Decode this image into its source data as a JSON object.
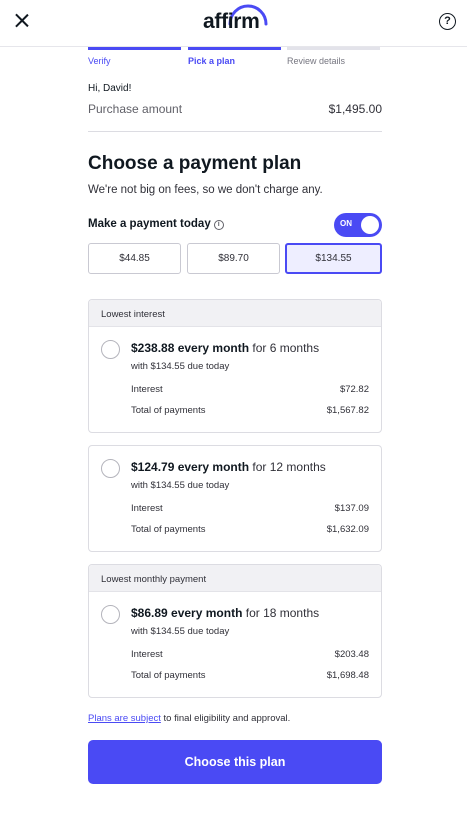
{
  "header": {
    "logo": "affirm",
    "help": "?"
  },
  "steps": [
    {
      "label": "Verify",
      "state": "done"
    },
    {
      "label": "Pick a plan",
      "state": "active"
    },
    {
      "label": "Review details",
      "state": "todo"
    }
  ],
  "greeting": "Hi, David!",
  "purchase": {
    "label": "Purchase amount",
    "value": "$1,495.00"
  },
  "heading": "Choose a payment plan",
  "subtext": "We're not big on fees, so we don't charge any.",
  "pay_today": {
    "label": "Make a payment today",
    "info_icon": "i",
    "toggle_label": "ON",
    "toggle_on": true,
    "amounts": [
      "$44.85",
      "$89.70",
      "$134.55"
    ],
    "selected_amount": "$134.55"
  },
  "plans": [
    {
      "tag": "Lowest interest",
      "monthly": "$238.88 every month",
      "term": " for 6 months",
      "due": "with $134.55 due today",
      "interest_label": "Interest",
      "interest": "$72.82",
      "total_label": "Total of payments",
      "total": "$1,567.82"
    },
    {
      "tag": "",
      "monthly": "$124.79 every month",
      "term": " for 12 months",
      "due": "with $134.55 due today",
      "interest_label": "Interest",
      "interest": "$137.09",
      "total_label": "Total of payments",
      "total": "$1,632.09"
    },
    {
      "tag": "Lowest monthly payment",
      "monthly": "$86.89 every month",
      "term": " for 18 months",
      "due": "with $134.55 due today",
      "interest_label": "Interest",
      "interest": "$203.48",
      "total_label": "Total of payments",
      "total": "$1,698.48"
    }
  ],
  "fine_print": {
    "link": "Plans are subject",
    "rest": " to final eligibility and approval."
  },
  "cta": "Choose this plan",
  "colors": {
    "accent": "#4a4af4",
    "selected_bg": "#eeeeff"
  },
  "icons": {
    "close": "close-icon",
    "help": "help-icon",
    "info": "info-icon",
    "logo_arc": "affirm-arc-icon"
  }
}
